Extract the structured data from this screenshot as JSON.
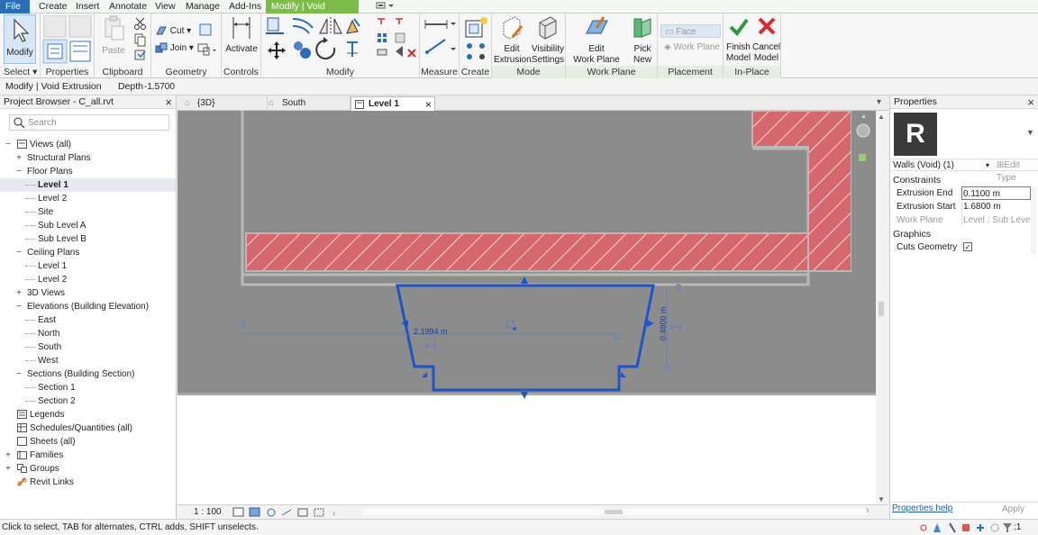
{
  "ribbon_tabs": [
    "File",
    "Create",
    "Insert",
    "Annotate",
    "View",
    "Manage",
    "Add-Ins",
    "Modify | Void Extrusion"
  ],
  "ribbon": {
    "select": {
      "modify_label": "Modify",
      "panel": "Select"
    },
    "properties": {
      "panel": "Properties"
    },
    "clipboard": {
      "paste": "Paste",
      "panel": "Clipboard"
    },
    "geometry": {
      "cut": "Cut",
      "join": "Join",
      "panel": "Geometry"
    },
    "controls": {
      "activate": "Activate",
      "panel": "Controls"
    },
    "modify": {
      "panel": "Modify"
    },
    "measure": {
      "panel": "Measure"
    },
    "create": {
      "panel": "Create"
    },
    "mode": {
      "edit_extrusion": [
        "Edit",
        "Extrusion"
      ],
      "visibility_settings": [
        "Visibility",
        "Settings"
      ],
      "panel": "Mode"
    },
    "work_plane": {
      "edit_work_plane": [
        "Edit",
        "Work Plane"
      ],
      "pick_new": [
        "Pick",
        "New"
      ],
      "panel": "Work Plane"
    },
    "placement": {
      "face": "Face",
      "work_plane": "Work Plane",
      "panel": "Placement"
    },
    "in_place_editor": {
      "finish_model": [
        "Finish",
        "Model"
      ],
      "cancel_model": [
        "Cancel",
        "Model"
      ],
      "panel": "In-Place Editor"
    }
  },
  "options_bar": {
    "context": "Modify | Void Extrusion",
    "depth_label": "Depth",
    "depth_value": "-1.5700"
  },
  "project_browser": {
    "title": "Project Browser - C_all.rvt",
    "search_placeholder": "Search",
    "tree": [
      {
        "label": "Views (all)",
        "level": 0,
        "toggle": "minus",
        "icon": "views"
      },
      {
        "label": "Structural Plans",
        "level": 1,
        "toggle": "plus"
      },
      {
        "label": "Floor Plans",
        "level": 1,
        "toggle": "minus"
      },
      {
        "label": "Level 1",
        "level": 2,
        "bold": true,
        "selected": true
      },
      {
        "label": "Level 2",
        "level": 2
      },
      {
        "label": "Site",
        "level": 2
      },
      {
        "label": "Sub Level A",
        "level": 2
      },
      {
        "label": "Sub Level B",
        "level": 2
      },
      {
        "label": "Ceiling Plans",
        "level": 1,
        "toggle": "minus"
      },
      {
        "label": "Level 1",
        "level": 2
      },
      {
        "label": "Level 2",
        "level": 2
      },
      {
        "label": "3D Views",
        "level": 1,
        "toggle": "plus"
      },
      {
        "label": "Elevations (Building Elevation)",
        "level": 1,
        "toggle": "minus"
      },
      {
        "label": "East",
        "level": 2
      },
      {
        "label": "North",
        "level": 2
      },
      {
        "label": "South",
        "level": 2
      },
      {
        "label": "West",
        "level": 2
      },
      {
        "label": "Sections (Building Section)",
        "level": 1,
        "toggle": "minus"
      },
      {
        "label": "Section 1",
        "level": 2
      },
      {
        "label": "Section 2",
        "level": 2
      },
      {
        "label": "Legends",
        "level": 0,
        "icon": "legend"
      },
      {
        "label": "Schedules/Quantities (all)",
        "level": 0,
        "icon": "schedule"
      },
      {
        "label": "Sheets (all)",
        "level": 0,
        "icon": "sheet"
      },
      {
        "label": "Families",
        "level": 0,
        "toggle": "plus",
        "icon": "family"
      },
      {
        "label": "Groups",
        "level": 0,
        "toggle": "plus",
        "icon": "group"
      },
      {
        "label": "Revit Links",
        "level": 0,
        "icon": "link"
      }
    ]
  },
  "view_tabs": [
    {
      "label": "{3D}",
      "icon": "house-3d-icon"
    },
    {
      "label": "South",
      "icon": "elevation-icon"
    },
    {
      "label": "Level 1",
      "icon": "plan-icon",
      "active": true
    }
  ],
  "canvas": {
    "dimension_width": "2.1994 m",
    "dimension_depth": "0.4800 m"
  },
  "view_control": {
    "scale": "1 : 100"
  },
  "properties": {
    "title": "Properties",
    "type_selector": "Walls (Void) (1)",
    "edit_type": "Edit Type",
    "sections": [
      {
        "name": "Constraints",
        "rows": [
          {
            "key": "Extrusion End",
            "value": "0.1100 m",
            "editable": true,
            "focused": true
          },
          {
            "key": "Extrusion Start",
            "value": "1.6800 m",
            "editable": true
          },
          {
            "key": "Work Plane",
            "value": "Level : Sub Level A",
            "editable": false
          }
        ]
      },
      {
        "name": "Graphics",
        "rows": [
          {
            "key": "Cuts Geometry",
            "checkbox": true,
            "checked": true
          }
        ]
      }
    ],
    "help_link": "Properties help",
    "apply": "Apply"
  },
  "status_bar": {
    "text": "Click to select, TAB for alternates, CTRL adds, SHIFT unselects.",
    "filter_count": ":1"
  },
  "colors": {
    "accent_blue": "#1f54c4",
    "wall_hatch": "#d5676f",
    "contextual_tab": "#7cbd4a",
    "canvas_gray": "#8c8c8c"
  }
}
